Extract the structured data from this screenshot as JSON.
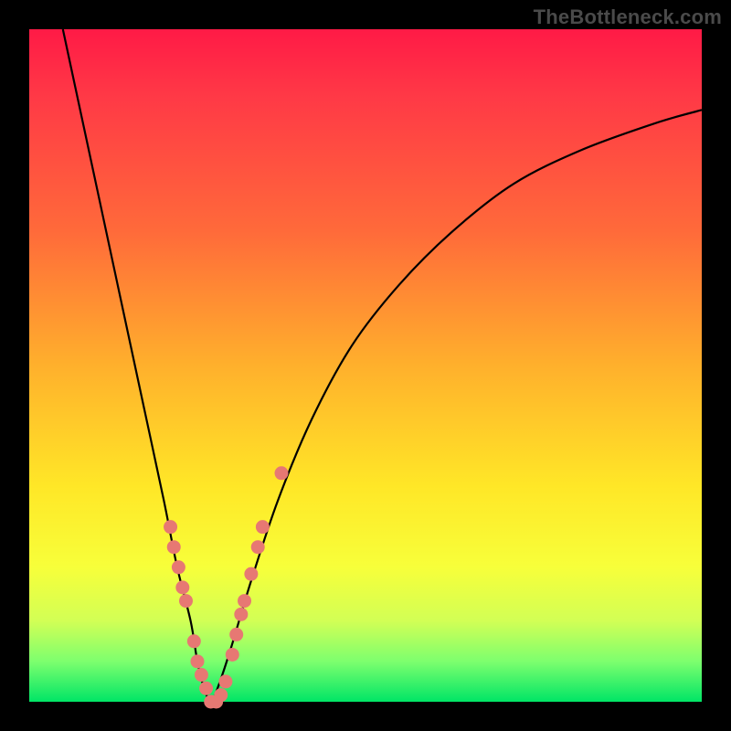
{
  "watermark": "TheBottleneck.com",
  "colors": {
    "frame": "#000000",
    "gradient_stops": [
      "#ff1a46",
      "#ff3946",
      "#ff6a3a",
      "#ffb02c",
      "#ffe727",
      "#f7ff3a",
      "#d2ff55",
      "#7dff6e",
      "#00e566"
    ],
    "curve": "#000000",
    "dots": "#e77873"
  },
  "chart_data": {
    "type": "line",
    "title": "",
    "xlabel": "",
    "ylabel": "",
    "xlim": [
      0,
      100
    ],
    "ylim": [
      0,
      100
    ],
    "grid": false,
    "legend": false,
    "annotations": [
      "TheBottleneck.com"
    ],
    "series": [
      {
        "name": "bottleneck-curve",
        "x": [
          5,
          8,
          11,
          14,
          17,
          20,
          22,
          24,
          25,
          26,
          27,
          28,
          30,
          33,
          37,
          42,
          48,
          55,
          63,
          72,
          82,
          93,
          100
        ],
        "y": [
          100,
          86,
          72,
          58,
          44,
          30,
          20,
          12,
          6,
          2,
          0,
          2,
          8,
          18,
          30,
          42,
          53,
          62,
          70,
          77,
          82,
          86,
          88
        ]
      }
    ],
    "scatter_points": {
      "name": "highlighted-points",
      "x": [
        21.0,
        21.5,
        22.2,
        22.8,
        23.3,
        24.5,
        25.0,
        25.6,
        26.3,
        27.0,
        27.8,
        28.5,
        29.2,
        30.2,
        30.8,
        31.5,
        32.0,
        33.0,
        34.0,
        34.7,
        37.5
      ],
      "y": [
        26,
        23,
        20,
        17,
        15,
        9,
        6,
        4,
        2,
        0,
        0,
        1,
        3,
        7,
        10,
        13,
        15,
        19,
        23,
        26,
        34
      ]
    },
    "notch_min_x": 27,
    "notes": "V-shaped bottleneck curve on a vertical rainbow gradient; salmon dots cluster near the trough and lower branches."
  }
}
